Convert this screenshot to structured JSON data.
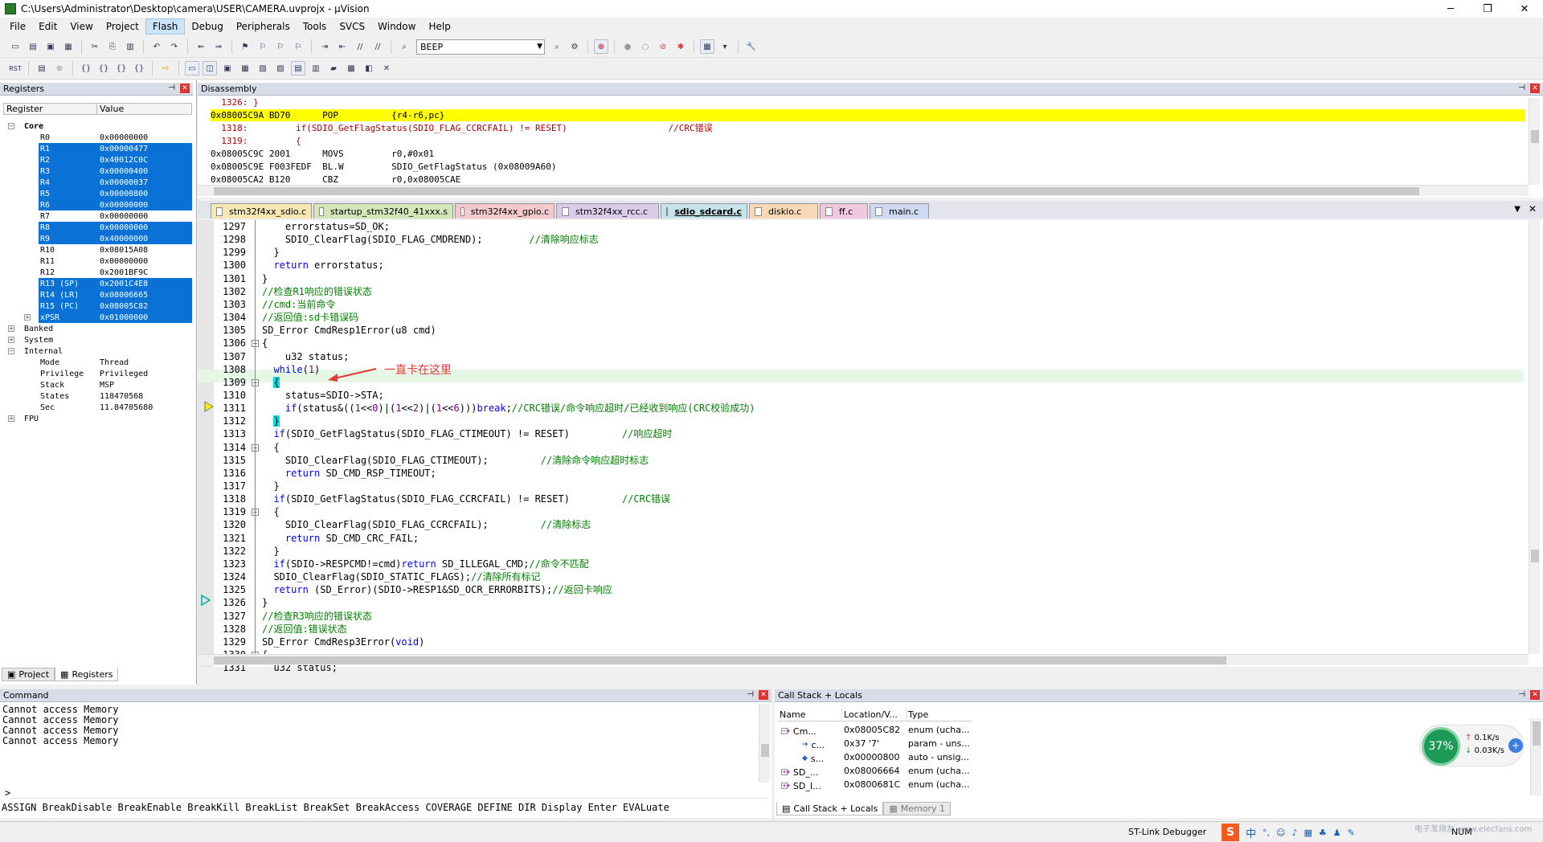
{
  "window": {
    "title": "C:\\Users\\Administrator\\Desktop\\camera\\USER\\CAMERA.uvprojx - µVision",
    "min": "─",
    "max": "❐",
    "close": "✕"
  },
  "menu": [
    "File",
    "Edit",
    "View",
    "Project",
    "Flash",
    "Debug",
    "Peripherals",
    "Tools",
    "SVCS",
    "Window",
    "Help"
  ],
  "toolbar": {
    "target_combo": "BEEP"
  },
  "registers": {
    "title": "Registers",
    "col_register": "Register",
    "col_value": "Value",
    "core_label": "Core",
    "rows": [
      {
        "name": "R0",
        "value": "0x00000000",
        "sel": false
      },
      {
        "name": "R1",
        "value": "0x00000477",
        "sel": true
      },
      {
        "name": "R2",
        "value": "0x40012C0C",
        "sel": true
      },
      {
        "name": "R3",
        "value": "0x00000400",
        "sel": true
      },
      {
        "name": "R4",
        "value": "0x00000037",
        "sel": true
      },
      {
        "name": "R5",
        "value": "0x00000800",
        "sel": true
      },
      {
        "name": "R6",
        "value": "0x00000000",
        "sel": true
      },
      {
        "name": "R7",
        "value": "0x00000000",
        "sel": false
      },
      {
        "name": "R8",
        "value": "0x00000000",
        "sel": true
      },
      {
        "name": "R9",
        "value": "0x40000000",
        "sel": true
      },
      {
        "name": "R10",
        "value": "0x08015A08",
        "sel": false
      },
      {
        "name": "R11",
        "value": "0x00000000",
        "sel": false
      },
      {
        "name": "R12",
        "value": "0x2001BF9C",
        "sel": false
      },
      {
        "name": "R13 (SP)",
        "value": "0x2001C4E8",
        "sel": true
      },
      {
        "name": "R14 (LR)",
        "value": "0x08006665",
        "sel": true
      },
      {
        "name": "R15 (PC)",
        "value": "0x08005C82",
        "sel": true
      },
      {
        "name": "xPSR",
        "value": "0x01000000",
        "sel": true
      }
    ],
    "groups": [
      "Banked",
      "System",
      "Internal"
    ],
    "internal": [
      {
        "name": "Mode",
        "value": "Thread"
      },
      {
        "name": "Privilege",
        "value": "Privileged"
      },
      {
        "name": "Stack",
        "value": "MSP"
      },
      {
        "name": "States",
        "value": "118470568"
      },
      {
        "name": "Sec",
        "value": "11.84705680"
      }
    ],
    "fpu": "FPU",
    "tab_project": "Project",
    "tab_registers": "Registers"
  },
  "disassembly": {
    "title": "Disassembly",
    "lines": [
      {
        "text": "  1326: }",
        "hl": false
      },
      {
        "text": "0x08005C9A BD70      POP          {r4-r6,pc}",
        "hl": true
      },
      {
        "text": "  1318:         if(SDIO_GetFlagStatus(SDIO_FLAG_CCRCFAIL) != RESET)                   //CRC错误",
        "hl": false
      },
      {
        "text": "  1319:         {",
        "hl": false
      },
      {
        "text": "0x08005C9C 2001      MOVS         r0,#0x01",
        "hl": false
      },
      {
        "text": "0x08005C9E F003FEDF  BL.W         SDIO_GetFlagStatus (0x08009A60)",
        "hl": false
      },
      {
        "text": "0x08005CA2 B120      CBZ          r0,0x08005CAE",
        "hl": false
      }
    ]
  },
  "editor_tabs": [
    {
      "label": "stm32f4xx_sdio.c",
      "color": "#f7e7b4",
      "active": false
    },
    {
      "label": "startup_stm32f40_41xxx.s",
      "color": "#d3e6b8",
      "active": false
    },
    {
      "label": "stm32f4xx_gpio.c",
      "color": "#f4c9cc",
      "active": false
    },
    {
      "label": "stm32f4xx_rcc.c",
      "color": "#d9cce8",
      "active": false
    },
    {
      "label": "sdio_sdcard.c",
      "color": "#c5e3ea",
      "active": true
    },
    {
      "label": "diskio.c",
      "color": "#f8d8b5",
      "active": false
    },
    {
      "label": "ff.c",
      "color": "#f0c8de",
      "active": false
    },
    {
      "label": "main.c",
      "color": "#cfdaf0",
      "active": false
    }
  ],
  "code": [
    {
      "ln": "1297",
      "html": "    errorstatus=SD_OK;"
    },
    {
      "ln": "1298",
      "html": "    SDIO_ClearFlag(SDIO_FLAG_CMDREND);        <span class=\"cm\">//清除响应标志</span>"
    },
    {
      "ln": "1299",
      "html": "  }"
    },
    {
      "ln": "1300",
      "html": "  <span class=\"kw\">return</span> errorstatus;"
    },
    {
      "ln": "1301",
      "html": "}"
    },
    {
      "ln": "1302",
      "html": "<span class=\"cm\">//检查R1响应的错误状态</span>"
    },
    {
      "ln": "1303",
      "html": "<span class=\"cm\">//cmd:当前命令</span>"
    },
    {
      "ln": "1304",
      "html": "<span class=\"cm\">//返回值:sd卡错误码</span>"
    },
    {
      "ln": "1305",
      "html": "SD_Error CmdResp1Error(u8 cmd)"
    },
    {
      "ln": "1306",
      "html": "{"
    },
    {
      "ln": "1307",
      "html": "    u32 status;"
    },
    {
      "ln": "1308",
      "html": "  <span class=\"kw\">while</span>(<span class=\"num\">1</span>)"
    },
    {
      "ln": "1309",
      "html": "  <span style=\"background:#00e0e0\">{</span>"
    },
    {
      "ln": "1310",
      "html": "    status=SDIO->STA;"
    },
    {
      "ln": "1311",
      "html": "    <span class=\"kw\">if</span>(status&amp;((<span class=\"num\">1</span>&lt;&lt;<span class=\"num\">0</span>)|(<span class=\"num\">1</span>&lt;&lt;<span class=\"num\">2</span>)|(<span class=\"num\">1</span>&lt;&lt;<span class=\"num\">6</span>)))<span class=\"kw\">break</span>;<span class=\"cm\">//CRC错误/命令响应超时/已经收到响应(CRC校验成功)</span>"
    },
    {
      "ln": "1312",
      "html": "  <span style=\"background:#00e0e0\">}</span>"
    },
    {
      "ln": "1313",
      "html": "  <span class=\"kw\">if</span>(SDIO_GetFlagStatus(SDIO_FLAG_CTIMEOUT) != RESET)         <span class=\"cm\">//响应超时</span>"
    },
    {
      "ln": "1314",
      "html": "  {"
    },
    {
      "ln": "1315",
      "html": "    SDIO_ClearFlag(SDIO_FLAG_CTIMEOUT);         <span class=\"cm\">//清除命令响应超时标志</span>"
    },
    {
      "ln": "1316",
      "html": "    <span class=\"kw\">return</span> SD_CMD_RSP_TIMEOUT;"
    },
    {
      "ln": "1317",
      "html": "  }"
    },
    {
      "ln": "1318",
      "html": "  <span class=\"kw\">if</span>(SDIO_GetFlagStatus(SDIO_FLAG_CCRCFAIL) != RESET)         <span class=\"cm\">//CRC错误</span>"
    },
    {
      "ln": "1319",
      "html": "  {"
    },
    {
      "ln": "1320",
      "html": "    SDIO_ClearFlag(SDIO_FLAG_CCRCFAIL);         <span class=\"cm\">//清除标志</span>"
    },
    {
      "ln": "1321",
      "html": "    <span class=\"kw\">return</span> SD_CMD_CRC_FAIL;"
    },
    {
      "ln": "1322",
      "html": "  }"
    },
    {
      "ln": "1323",
      "html": "  <span class=\"kw\">if</span>(SDIO->RESPCMD!=cmd)<span class=\"kw\">return</span> SD_ILLEGAL_CMD;<span class=\"cm\">//命令不匹配</span>"
    },
    {
      "ln": "1324",
      "html": "  SDIO_ClearFlag(SDIO_STATIC_FLAGS);<span class=\"cm\">//清除所有标记</span>"
    },
    {
      "ln": "1325",
      "html": "  <span class=\"kw\">return</span> (SD_Error)(SDIO->RESP1&amp;SD_OCR_ERRORBITS);<span class=\"cm\">//返回卡响应</span>"
    },
    {
      "ln": "1326",
      "html": "}"
    },
    {
      "ln": "1327",
      "html": "<span class=\"cm\">//检查R3响应的错误状态</span>"
    },
    {
      "ln": "1328",
      "html": "<span class=\"cm\">//返回值:错误状态</span>"
    },
    {
      "ln": "1329",
      "html": "SD_Error CmdResp3Error(<span class=\"kw\">void</span>)"
    },
    {
      "ln": "1330",
      "html": "{"
    },
    {
      "ln": "1331",
      "html": "  u32 status;"
    }
  ],
  "annotation": "一直卡在这里",
  "command": {
    "title": "Command",
    "lines": [
      "Cannot access Memory",
      "Cannot access Memory",
      "Cannot access Memory",
      "Cannot access Memory"
    ],
    "prompt": ">",
    "hint": "ASSIGN BreakDisable BreakEnable BreakKill BreakList BreakSet BreakAccess COVERAGE DEFINE DIR Display Enter EVALuate"
  },
  "callstack": {
    "title": "Call Stack + Locals",
    "col_name": "Name",
    "col_location": "Location/V...",
    "col_type": "Type",
    "rows": [
      {
        "name": "Cm...",
        "loc": "0x08005C82",
        "type": "enum (ucha..."
      },
      {
        "name": "c...",
        "loc": "0x37 '7'",
        "type": "param - uns..."
      },
      {
        "name": "s...",
        "loc": "0x00000800",
        "type": "auto - unsig..."
      },
      {
        "name": "SD_...",
        "loc": "0x08006664",
        "type": "enum (ucha..."
      },
      {
        "name": "SD_I...",
        "loc": "0x0800681C",
        "type": "enum (ucha..."
      }
    ],
    "tab_cs": "Call Stack + Locals",
    "tab_mem": "Memory 1"
  },
  "netwidget": {
    "percent": "37%",
    "up": "0.1K/s",
    "down": "0.03K/s"
  },
  "status": {
    "debugger": "ST-Link Debugger",
    "num": "NUM",
    "ime": "中"
  },
  "watermark": "电子发烧友 www.elecfans.com",
  "colors": {
    "selection": "#0a72d6",
    "hl_line": "#ffff00",
    "keyword": "#0000ff",
    "comment": "#008000",
    "annotation": "#e53935"
  }
}
